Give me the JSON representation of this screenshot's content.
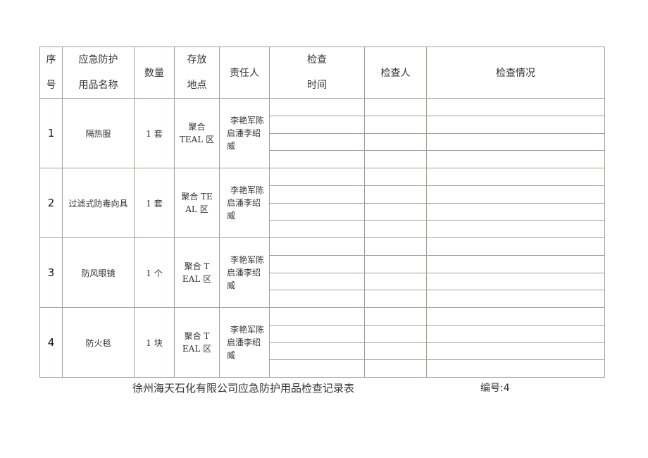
{
  "header": {
    "seq": [
      "序",
      "号"
    ],
    "item_name": [
      "应急防护",
      "用品名称"
    ],
    "quantity": "数量",
    "location": [
      "存放",
      "地点"
    ],
    "responsible": "责任人",
    "check_time": [
      "检查",
      "时间"
    ],
    "inspector": "检查人",
    "check_status": "检查情况"
  },
  "rows": [
    {
      "seq": "1",
      "name": "隔热服",
      "quantity": "1 套",
      "location": [
        "聚合",
        "TEAL 区"
      ],
      "responsible": [
        "李艳军陈",
        "启潘李绍",
        "威"
      ]
    },
    {
      "seq": "2",
      "name": "过滤式防毒向具",
      "quantity": "1 套",
      "location": [
        "聚合 TE",
        "AL 区"
      ],
      "responsible": [
        "李艳军陈",
        "启潘李绍",
        "威"
      ]
    },
    {
      "seq": "3",
      "name": "防风眼镜",
      "quantity": "1 个",
      "location": [
        "聚合 T",
        "EAL 区"
      ],
      "responsible": [
        "李艳军陈",
        "启潘李绍",
        "威"
      ]
    },
    {
      "seq": "4",
      "name": "防火毯",
      "quantity": "1 块",
      "location": [
        "聚合 T",
        "EAL 区"
      ],
      "responsible": [
        "李艳军陈",
        "启潘李绍",
        "威"
      ]
    }
  ],
  "footer": {
    "title": "徐州海天石化有限公司应急防护用品检查记录表",
    "serial": "编号:4"
  }
}
